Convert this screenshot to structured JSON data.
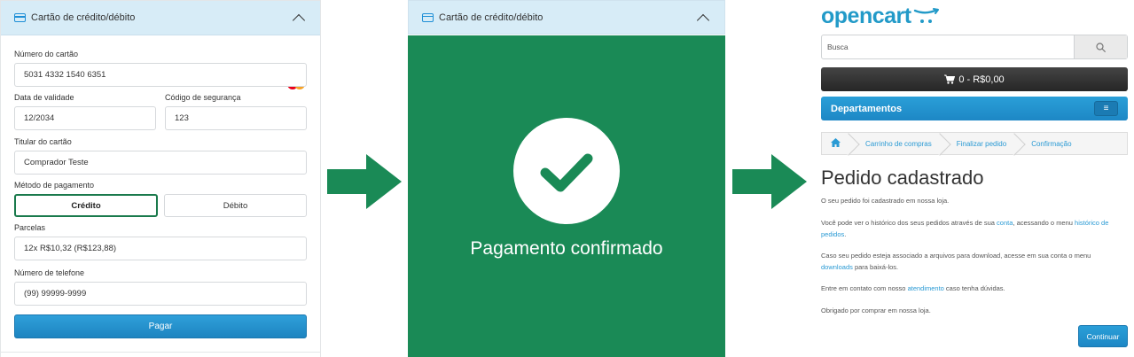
{
  "payment_form": {
    "header_title": "Cartão de crédito/débito",
    "card_number_label": "Número do cartão",
    "card_number_value": "5031 4332 1540 6351",
    "expiry_label": "Data de validade",
    "expiry_value": "12/2034",
    "cvv_label": "Código de segurança",
    "cvv_value": "123",
    "holder_label": "Titular do cartão",
    "holder_value": "Comprador Teste",
    "method_label": "Método de pagamento",
    "method_credit": "Crédito",
    "method_debit": "Débito",
    "installments_label": "Parcelas",
    "installments_value": "12x R$10,32 (R$123,88)",
    "phone_label": "Número de telefone",
    "phone_value": "(99) 99999-9999",
    "pay_button": "Pagar",
    "card_brand_icon": "mastercard-icon"
  },
  "confirmation": {
    "header_title": "Cartão de crédito/débito",
    "message": "Pagamento confirmado",
    "background_color": "#1a8a56"
  },
  "store": {
    "logo_text": "opencart",
    "search_placeholder": "Busca",
    "cart_summary": "0 - R$0,00",
    "departments_label": "Departamentos",
    "breadcrumb": [
      "Carrinho de compras",
      "Finalizar pedido",
      "Confirmação"
    ],
    "page_title": "Pedido cadastrado",
    "para1": "O seu pedido foi cadastrado em nossa loja.",
    "para2_before": "Você pode ver o histórico dos seus pedidos através de sua ",
    "para2_link1": "conta",
    "para2_mid": ", acessando o menu ",
    "para2_link2": "histórico de pedidos",
    "para2_after": ".",
    "para3_before": "Caso seu pedido esteja associado a arquivos para download, acesse em sua conta o menu ",
    "para3_link": "downloads",
    "para3_after": " para baixá-los.",
    "para4_before": "Entre em contato com nosso ",
    "para4_link": "atendimento",
    "para4_after": " caso tenha dúvidas.",
    "para5": "Obrigado por comprar em nossa loja.",
    "continue_button": "Continuar"
  }
}
